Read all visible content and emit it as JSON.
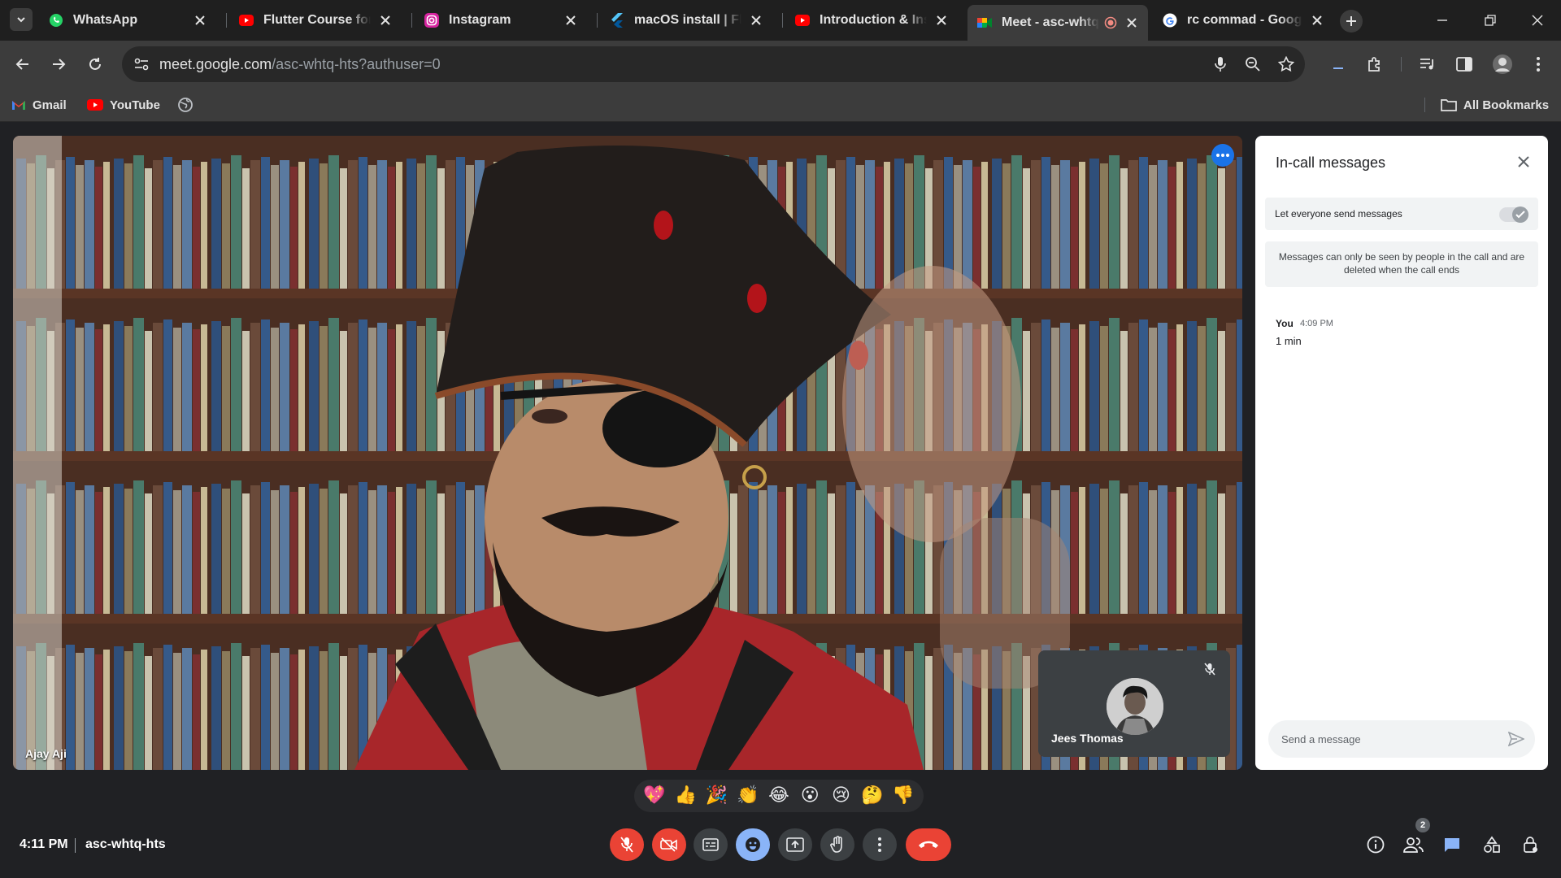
{
  "tabs": [
    {
      "title": "WhatsApp",
      "icon": "whatsapp-icon"
    },
    {
      "title": "Flutter Course for Be",
      "icon": "youtube-icon"
    },
    {
      "title": "Instagram",
      "icon": "instagram-icon"
    },
    {
      "title": "macOS install | Flutt",
      "icon": "flutter-icon"
    },
    {
      "title": "Introduction & Insta",
      "icon": "youtube-icon"
    },
    {
      "title": "Meet - asc-whtq",
      "icon": "google-meet-icon",
      "active": true,
      "recording": true
    },
    {
      "title": "rc commad - Google",
      "icon": "google-icon"
    }
  ],
  "address_bar": {
    "domain": "meet.google.com",
    "path": "/asc-whtq-hts?authuser=0"
  },
  "bookmarks": {
    "items": [
      {
        "label": "Gmail",
        "icon": "gmail-icon"
      },
      {
        "label": "YouTube",
        "icon": "youtube-icon"
      }
    ],
    "all_bookmarks": "All Bookmarks"
  },
  "meeting": {
    "main_participant": "Ajay Aji",
    "self_participant": "Jees Thomas",
    "time": "4:11 PM",
    "code": "asc-whtq-hts",
    "participant_count": "2"
  },
  "panel": {
    "title": "In-call messages",
    "permission_label": "Let everyone send messages",
    "permission_enabled": true,
    "info": "Messages can only be seen by people in the call and are deleted when the call ends",
    "messages": [
      {
        "sender": "You",
        "time": "4:09 PM",
        "text": "1 min"
      }
    ],
    "input_placeholder": "Send a message"
  },
  "reactions": [
    "💖",
    "👍",
    "🎉",
    "👏",
    "😂",
    "😮",
    "😢",
    "🤔",
    "👎"
  ],
  "colors": {
    "accent_blue": "#8ab4f8",
    "danger_red": "#ea4335",
    "meet_bg": "#202124"
  }
}
